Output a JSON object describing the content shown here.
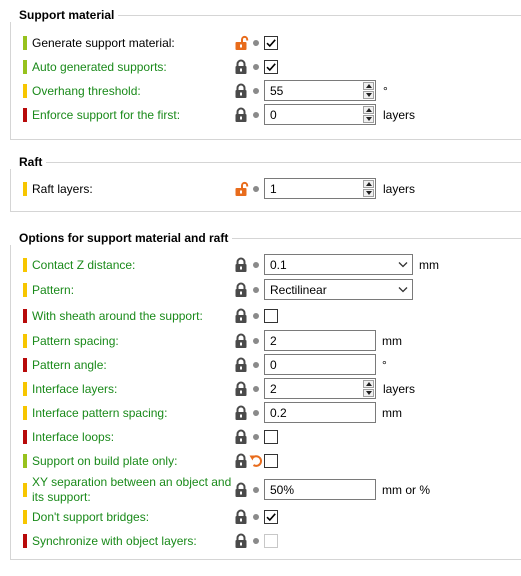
{
  "colors": {
    "mode_green": "#97c21d",
    "mode_yellow": "#f7c600",
    "mode_red": "#b80a0a",
    "label_green": "#1a8a1a",
    "lock_gray": "#4a4a4a",
    "lock_open_orange": "#e86c1c",
    "undo_orange": "#e86c1c"
  },
  "groups": [
    {
      "title": "Support material",
      "rows": [
        {
          "label": "Generate support material:",
          "label_color": "black",
          "mode": "green",
          "lock": "open",
          "control": "checkbox",
          "checked": true
        },
        {
          "label": "Auto generated supports:",
          "label_color": "green",
          "mode": "green",
          "lock": "closed",
          "control": "checkbox",
          "checked": true
        },
        {
          "label": "Overhang threshold:",
          "label_color": "green",
          "mode": "yellow",
          "lock": "closed",
          "control": "spin",
          "value": "55",
          "unit": "°"
        },
        {
          "label": "Enforce support for the first:",
          "label_color": "green",
          "mode": "red",
          "lock": "closed",
          "control": "spin",
          "value": "0",
          "unit": "layers"
        }
      ]
    },
    {
      "title": "Raft",
      "rows": [
        {
          "label": "Raft layers:",
          "label_color": "black",
          "mode": "yellow",
          "lock": "open",
          "control": "spin",
          "value": "1",
          "unit": "layers"
        }
      ]
    },
    {
      "title": "Options for support material and raft",
      "rows": [
        {
          "label": "Contact Z distance:",
          "label_color": "green",
          "mode": "yellow",
          "lock": "closed",
          "control": "select",
          "value": "0.1",
          "unit": "mm"
        },
        {
          "label": "Pattern:",
          "label_color": "green",
          "mode": "yellow",
          "lock": "closed",
          "control": "select",
          "value": "Rectilinear",
          "unit": ""
        },
        {
          "label": "With sheath around the support:",
          "label_color": "green",
          "mode": "red",
          "lock": "closed",
          "control": "checkbox",
          "checked": false
        },
        {
          "label": "Pattern spacing:",
          "label_color": "green",
          "mode": "yellow",
          "lock": "closed",
          "control": "text",
          "value": "2",
          "unit": "mm"
        },
        {
          "label": "Pattern angle:",
          "label_color": "green",
          "mode": "red",
          "lock": "closed",
          "control": "text",
          "value": "0",
          "unit": "°"
        },
        {
          "label": "Interface layers:",
          "label_color": "green",
          "mode": "yellow",
          "lock": "closed",
          "control": "spin",
          "value": "2",
          "unit": "layers"
        },
        {
          "label": "Interface pattern spacing:",
          "label_color": "green",
          "mode": "yellow",
          "lock": "closed",
          "control": "text",
          "value": "0.2",
          "unit": "mm"
        },
        {
          "label": "Interface loops:",
          "label_color": "green",
          "mode": "red",
          "lock": "closed",
          "control": "checkbox",
          "checked": false
        },
        {
          "label": "Support on build plate only:",
          "label_color": "green",
          "mode": "green",
          "lock": "closed",
          "undo": true,
          "control": "checkbox",
          "checked": false
        },
        {
          "label": "XY separation between an object and its support:",
          "label_color": "green",
          "mode": "yellow",
          "lock": "closed",
          "control": "text",
          "value": "50%",
          "unit": "mm or %"
        },
        {
          "label": "Don't support bridges:",
          "label_color": "green",
          "mode": "yellow",
          "lock": "closed",
          "control": "checkbox",
          "checked": true
        },
        {
          "label": "Synchronize with object layers:",
          "label_color": "green",
          "mode": "red",
          "lock": "closed",
          "control": "checkbox",
          "checked": false,
          "disabled": true
        }
      ]
    }
  ]
}
